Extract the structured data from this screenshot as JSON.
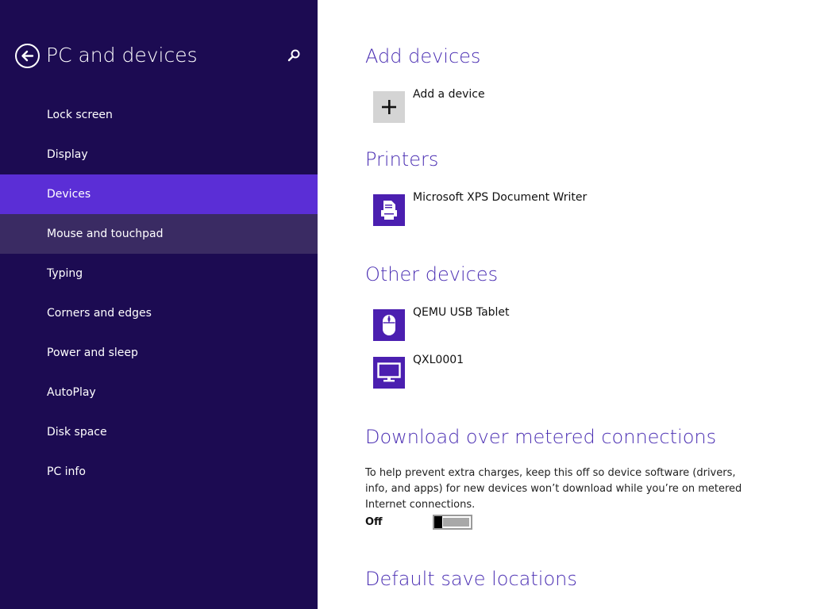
{
  "sidebar": {
    "title": "PC and devices",
    "back_icon": "back-arrow-icon",
    "search_icon": "search-icon",
    "items": [
      {
        "label": "Lock screen",
        "state": "normal"
      },
      {
        "label": "Display",
        "state": "normal"
      },
      {
        "label": "Devices",
        "state": "selected"
      },
      {
        "label": "Mouse and touchpad",
        "state": "hover"
      },
      {
        "label": "Typing",
        "state": "normal"
      },
      {
        "label": "Corners and edges",
        "state": "normal"
      },
      {
        "label": "Power and sleep",
        "state": "normal"
      },
      {
        "label": "AutoPlay",
        "state": "normal"
      },
      {
        "label": "Disk space",
        "state": "normal"
      },
      {
        "label": "PC info",
        "state": "normal"
      }
    ]
  },
  "main": {
    "add_devices": {
      "title": "Add devices",
      "add_label": "Add a device",
      "icon": "plus-icon"
    },
    "printers": {
      "title": "Printers",
      "items": [
        {
          "label": "Microsoft XPS Document Writer",
          "icon": "printer-icon"
        }
      ]
    },
    "other_devices": {
      "title": "Other devices",
      "items": [
        {
          "label": "QEMU USB Tablet",
          "icon": "mouse-icon"
        },
        {
          "label": "QXL0001",
          "icon": "monitor-icon"
        }
      ]
    },
    "metered": {
      "title": "Download over metered connections",
      "description": "To help prevent extra charges, keep this off so device software (drivers, info, and apps) for new devices won’t download while you’re on metered Internet connections.",
      "toggle_state": "Off"
    },
    "save_locations": {
      "title": "Default save locations"
    }
  },
  "colors": {
    "sidebar_bg": "#1c0b52",
    "selected_bg": "#5b2ed6",
    "hover_bg": "#3a2b63",
    "accent": "#4b2fb3",
    "icon_tile": "#4b1fb0"
  }
}
